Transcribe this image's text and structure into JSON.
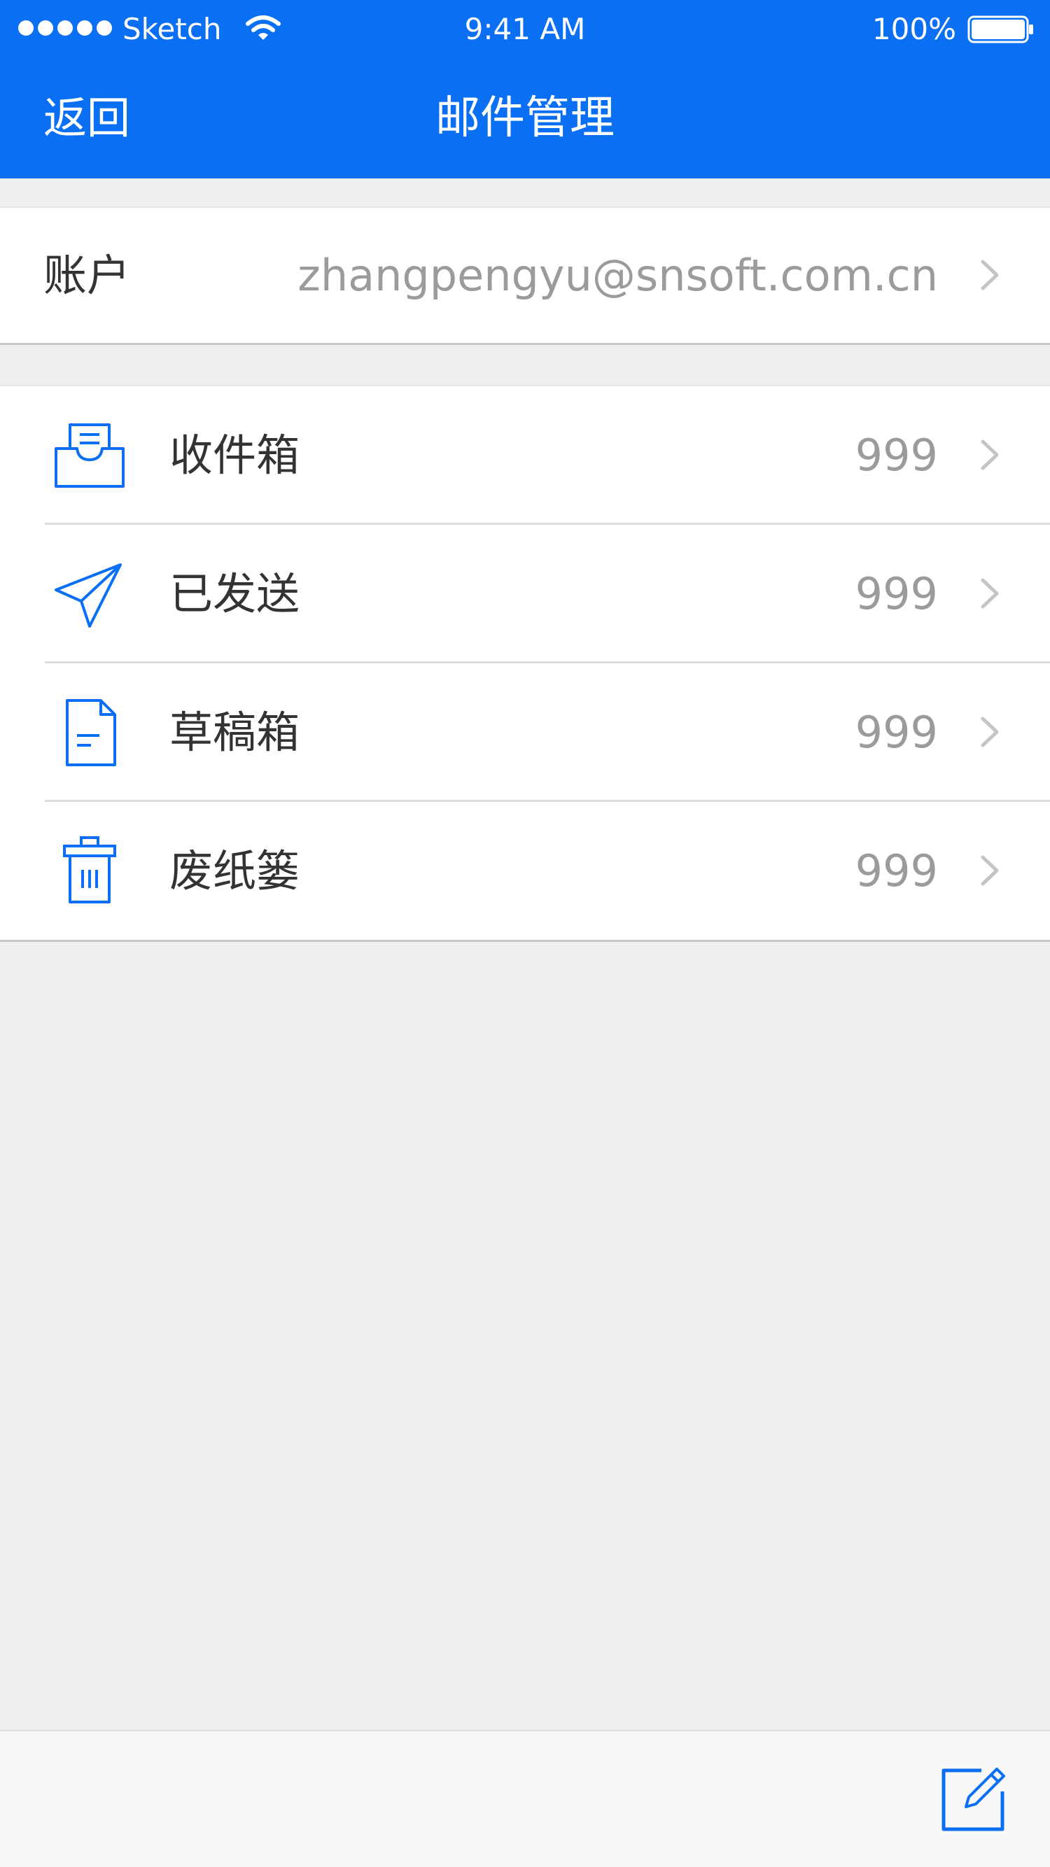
{
  "status_bar": {
    "carrier": "Sketch",
    "time": "9:41 AM",
    "battery": "100%"
  },
  "nav": {
    "back_label": "返回",
    "title": "邮件管理"
  },
  "account": {
    "label": "账户",
    "email": "zhangpengyu@snsoft.com.cn"
  },
  "folders": [
    {
      "label": "收件箱",
      "count": "999",
      "icon": "inbox-icon"
    },
    {
      "label": "已发送",
      "count": "999",
      "icon": "paper-plane-icon"
    },
    {
      "label": "草稿箱",
      "count": "999",
      "icon": "draft-document-icon"
    },
    {
      "label": "废纸篓",
      "count": "999",
      "icon": "trash-icon"
    }
  ],
  "toolbar": {
    "compose_icon": "compose-icon"
  },
  "colors": {
    "brand": "#0a6ff2",
    "background": "#efefef",
    "secondary_text": "#9b9b9b",
    "primary_text": "#333333"
  }
}
